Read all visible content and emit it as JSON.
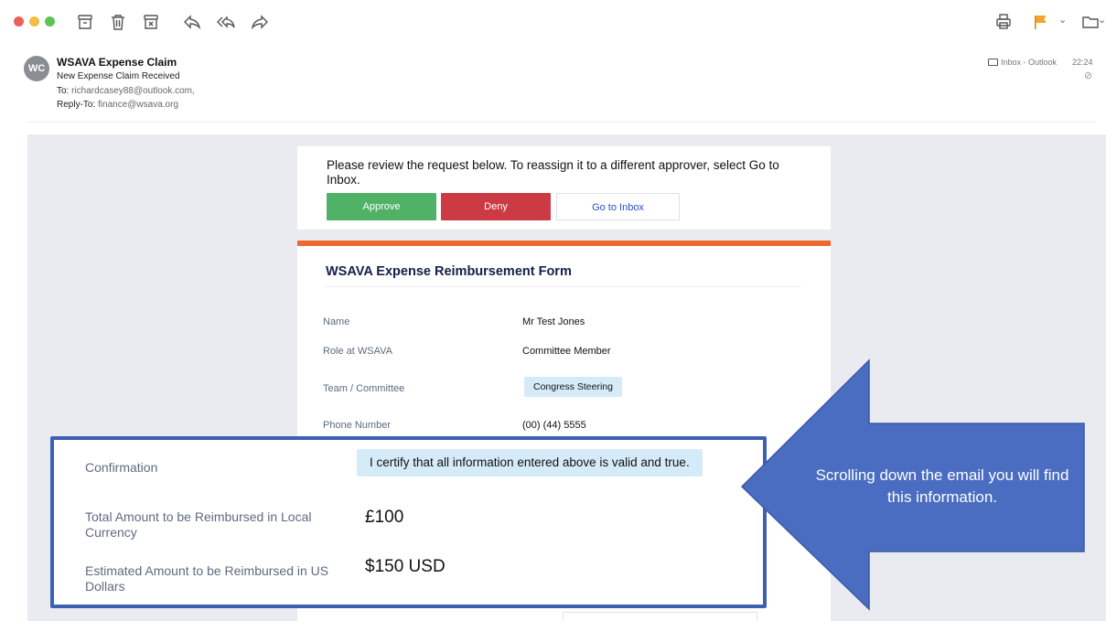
{
  "toolbar": {
    "icons": [
      "archive-icon",
      "trash-icon",
      "junk-icon",
      "reply-icon",
      "reply-all-icon",
      "forward-icon",
      "print-icon",
      "flag-icon",
      "move-icon"
    ],
    "colors": {
      "close": "#ee5f58",
      "minimize": "#f3bd41",
      "maximize": "#5fc452",
      "flag": "#f3a52b"
    }
  },
  "email": {
    "avatar_initials": "WC",
    "sender": "WSAVA Expense Claim",
    "subject": "New Expense Claim Received",
    "to_key": "To:",
    "to_value": "richardcasey88@outlook.com,",
    "reply_to_key": "Reply-To:",
    "reply_to_value": "finance@wsava.org",
    "folder": "Inbox - Outlook",
    "time": "22:24"
  },
  "notice": {
    "text": "Please review the request below. To reassign it to a different approver, select Go to Inbox.",
    "approve_label": "Approve",
    "deny_label": "Deny",
    "inbox_label": "Go to Inbox",
    "colors": {
      "approve": "#4fb266",
      "deny": "#cc3b44"
    }
  },
  "form": {
    "title": "WSAVA Expense Reimbursement Form",
    "accent_color": "#ec6a2c",
    "fields": [
      {
        "label": "Name",
        "value": "Mr Test Jones"
      },
      {
        "label": "Role at WSAVA",
        "value": "Committee Member"
      },
      {
        "label": "Team / Committee",
        "value": "Congress Steering"
      },
      {
        "label": "Phone Number",
        "value": "(00) (44) 5555"
      }
    ]
  },
  "callout": {
    "border_color": "#3e60b2",
    "confirmation_label": "Confirmation",
    "confirmation_value": "I certify that all information entered above is valid and true.",
    "local_label": "Total Amount to be Reimbursed in Local Currency",
    "local_value": "£100",
    "usd_label": "Estimated Amount to be Reimbursed in US Dollars",
    "usd_value": "$150 USD"
  },
  "arrow": {
    "text": "Scrolling down the email you will find this information.",
    "fill_color": "#4a6dc1"
  }
}
